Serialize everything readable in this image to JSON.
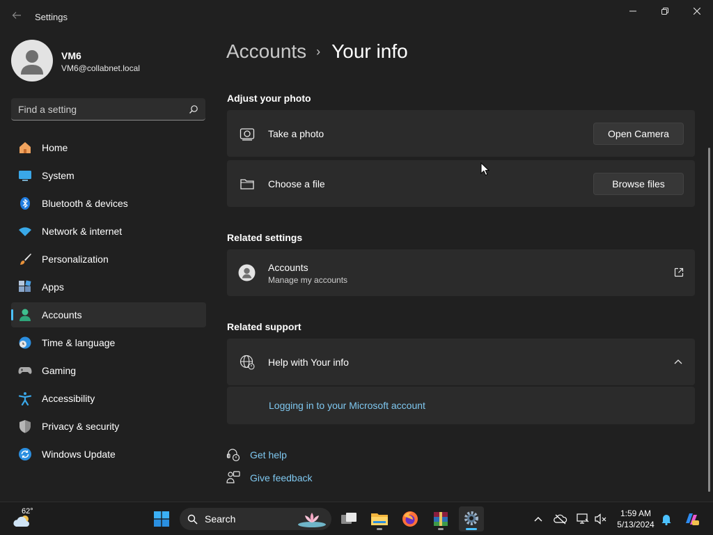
{
  "window": {
    "title": "Settings",
    "back_icon": "arrow-left-icon",
    "minimize_icon": "minimize-icon",
    "restore_icon": "restore-icon",
    "close_icon": "close-icon"
  },
  "profile": {
    "name": "VM6",
    "email": "VM6@collabnet.local",
    "avatar_icon": "person-icon"
  },
  "search": {
    "placeholder": "Find a setting",
    "icon": "search-icon"
  },
  "sidebar": {
    "items": [
      {
        "label": "Home",
        "icon": "home-icon"
      },
      {
        "label": "System",
        "icon": "monitor-icon"
      },
      {
        "label": "Bluetooth & devices",
        "icon": "bluetooth-icon"
      },
      {
        "label": "Network & internet",
        "icon": "wifi-icon"
      },
      {
        "label": "Personalization",
        "icon": "brush-icon"
      },
      {
        "label": "Apps",
        "icon": "apps-icon"
      },
      {
        "label": "Accounts",
        "icon": "accounts-icon",
        "selected": true
      },
      {
        "label": "Time & language",
        "icon": "globe-clock-icon"
      },
      {
        "label": "Gaming",
        "icon": "gamepad-icon"
      },
      {
        "label": "Accessibility",
        "icon": "accessibility-icon"
      },
      {
        "label": "Privacy & security",
        "icon": "shield-icon"
      },
      {
        "label": "Windows Update",
        "icon": "update-icon"
      }
    ]
  },
  "breadcrumb": {
    "parent": "Accounts",
    "separator": "›",
    "current": "Your info"
  },
  "adjust_photo": {
    "heading": "Adjust your photo",
    "take_photo": {
      "label": "Take a photo",
      "button": "Open Camera",
      "icon": "camera-icon"
    },
    "choose_file": {
      "label": "Choose a file",
      "button": "Browse files",
      "icon": "folder-icon"
    }
  },
  "related_settings": {
    "heading": "Related settings",
    "accounts": {
      "title": "Accounts",
      "subtitle": "Manage my accounts",
      "icon": "person-circle-icon",
      "action_icon": "open-external-icon"
    }
  },
  "related_support": {
    "heading": "Related support",
    "help": {
      "title": "Help with Your info",
      "icon": "globe-icon",
      "toggle_icon": "chevron-up-icon"
    },
    "link": "Logging in to your Microsoft account"
  },
  "footer": {
    "get_help": "Get help",
    "give_feedback": "Give feedback"
  },
  "taskbar": {
    "weather_temp": "62°",
    "search_label": "Search",
    "time": "1:59 AM",
    "date": "5/13/2024",
    "apps": [
      "start-icon",
      "task-view-icon",
      "file-explorer-icon",
      "firefox-icon",
      "winrar-icon",
      "settings-icon"
    ],
    "tray": [
      "chevron-up-icon",
      "onedrive-icon",
      "network-icon",
      "volume-muted-icon",
      "notification-bell-icon",
      "copilot-icon"
    ]
  },
  "colors": {
    "background": "#202020",
    "card": "#2b2b2b",
    "accent": "#4cc2ff",
    "link": "#7fc8f0"
  }
}
